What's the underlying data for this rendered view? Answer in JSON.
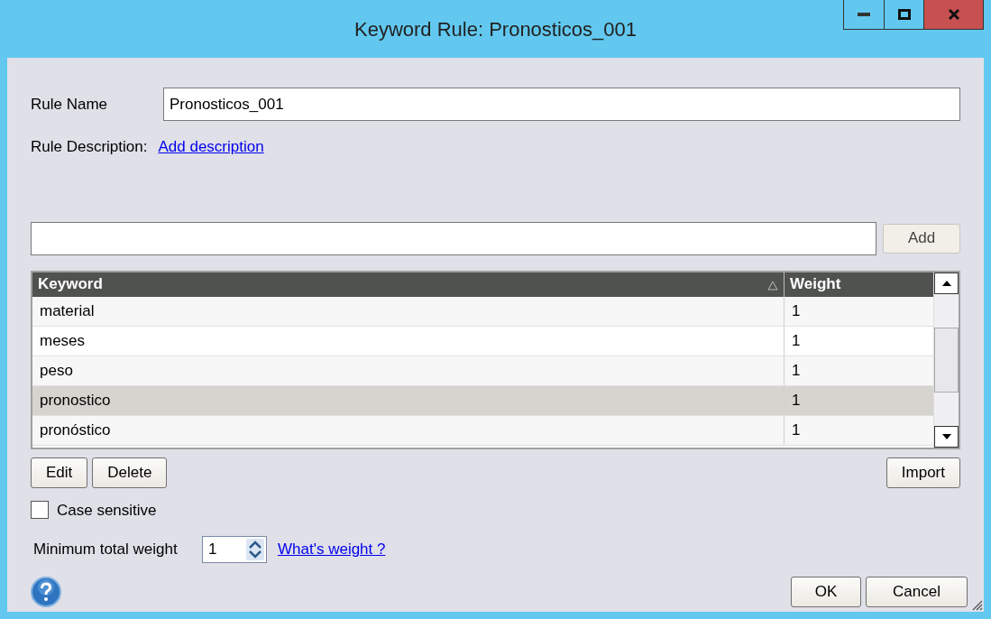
{
  "window": {
    "title": "Keyword Rule: Pronosticos_001"
  },
  "rule_name": {
    "label": "Rule Name",
    "value": "Pronosticos_001"
  },
  "rule_description": {
    "label": "Rule Description:",
    "link": "Add description"
  },
  "keyword_input": {
    "button": "Add"
  },
  "table": {
    "columns": [
      {
        "label": "Keyword",
        "sorted": true
      },
      {
        "label": "Weight",
        "sorted": false
      }
    ],
    "rows": [
      {
        "keyword": "material",
        "weight": "1",
        "selected": false
      },
      {
        "keyword": "meses",
        "weight": "1",
        "selected": false
      },
      {
        "keyword": "peso",
        "weight": "1",
        "selected": false
      },
      {
        "keyword": "pronostico",
        "weight": "1",
        "selected": true
      },
      {
        "keyword": "pronóstico",
        "weight": "1",
        "selected": false
      }
    ]
  },
  "row_buttons": [
    "Edit",
    "Delete"
  ],
  "import_button": "Import",
  "case_sensitive": {
    "label": "Case sensitive",
    "checked": false
  },
  "minimum_weight": {
    "label": "Minimum total weight",
    "value": "1",
    "link": "What's weight ?"
  },
  "footer_buttons": [
    "OK",
    "Cancel"
  ]
}
